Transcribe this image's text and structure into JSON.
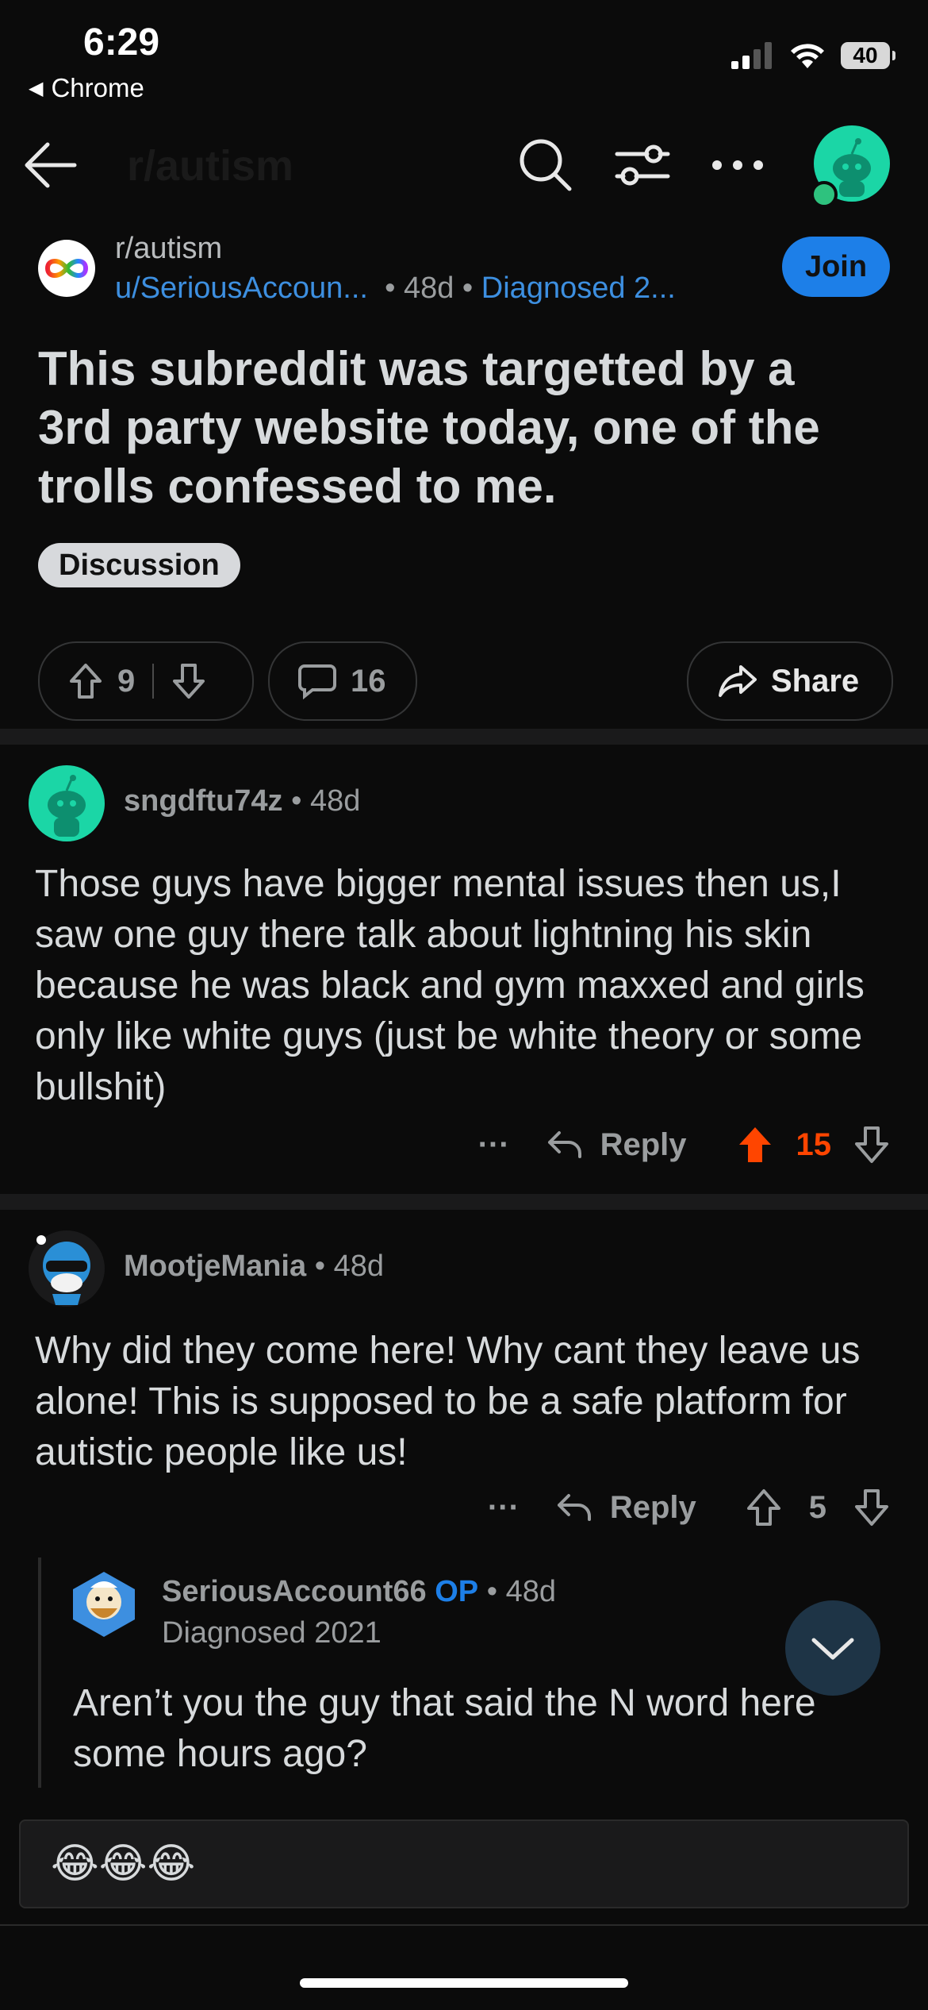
{
  "status": {
    "time": "6:29",
    "back_app": "Chrome",
    "battery": "40"
  },
  "header": {
    "title": "r/autism"
  },
  "post": {
    "subreddit": "r/autism",
    "author": "u/SeriousAccoun...",
    "age": "48d",
    "author_flair": "Diagnosed 2...",
    "join_label": "Join",
    "title": "This subreddit was targetted by a 3rd party website today, one of the trolls confessed to me.",
    "flair": "Discussion",
    "votes": "9",
    "comments": "16",
    "share_label": "Share"
  },
  "comments": [
    {
      "user": "sngdftu74z",
      "age": "48d",
      "body": "Those guys have bigger mental issues then us,I saw one guy there talk about lightning his skin because he was black and gym maxxed and girls only like white guys (just be white theory or some bullshit)",
      "reply_label": "Reply",
      "votes": "15",
      "upvoted": true,
      "more": "···"
    },
    {
      "user": "MootjeMania",
      "age": "48d",
      "body": "Why did they come here! Why cant they leave us alone! This is supposed to be a safe platform for autistic people like us!",
      "reply_label": "Reply",
      "votes": "5",
      "upvoted": false,
      "more": "···"
    },
    {
      "user": "SeriousAccount66",
      "op_label": "OP",
      "age": "48d",
      "flair": "Diagnosed 2021",
      "body": "Aren’t you the guy that said the N word here some hours ago?"
    }
  ],
  "composer": {
    "text": "😂😂😂"
  },
  "colors": {
    "accent_blue": "#1d7fe8",
    "upvote_orange": "#ff4500",
    "snoo_teal": "#1bd6a6"
  }
}
